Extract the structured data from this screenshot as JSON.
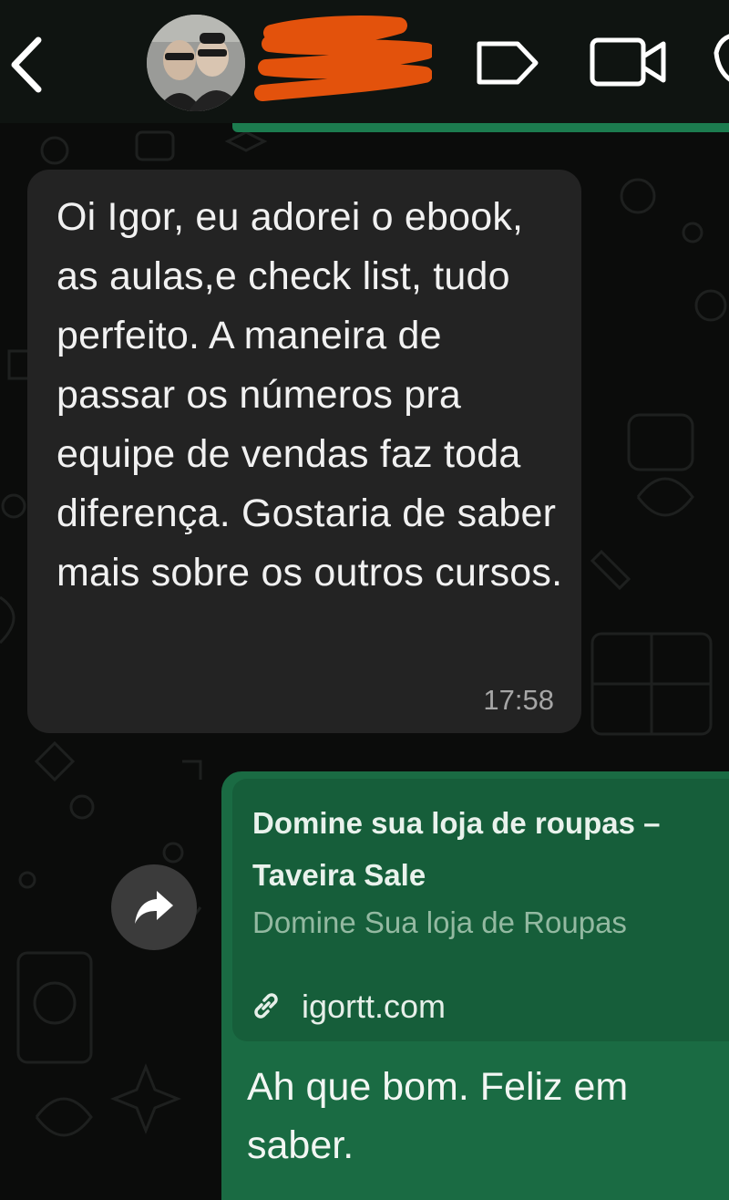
{
  "colors": {
    "header_bg": "#0f1411",
    "chat_bg": "#0b0c0b",
    "incoming_bubble": "#232323",
    "outgoing_bubble": "#1a6b43",
    "link_preview_bg": "#165e3a",
    "redaction": "#e3520c"
  },
  "header": {
    "back_icon": "chevron-left-icon",
    "icons": [
      "label-tag-icon",
      "video-camera-icon",
      "phone-icon"
    ]
  },
  "messages": {
    "incoming": {
      "text": "Oi Igor, eu adorei o ebook, as aulas,e check list, tudo perfeito. A maneira de passar os números pra equipe de vendas faz toda diferença. Gostaria de saber mais sobre os outros cursos.",
      "time": "17:58"
    },
    "outgoing": {
      "link_preview": {
        "title": "Domine sua loja de roupas – Taveira Sale",
        "description": "Domine Sua loja de Roupas",
        "domain": "igortt.com"
      },
      "text": "Ah que bom. Feliz em saber."
    }
  },
  "forward_icon": "forward-arrow-icon"
}
